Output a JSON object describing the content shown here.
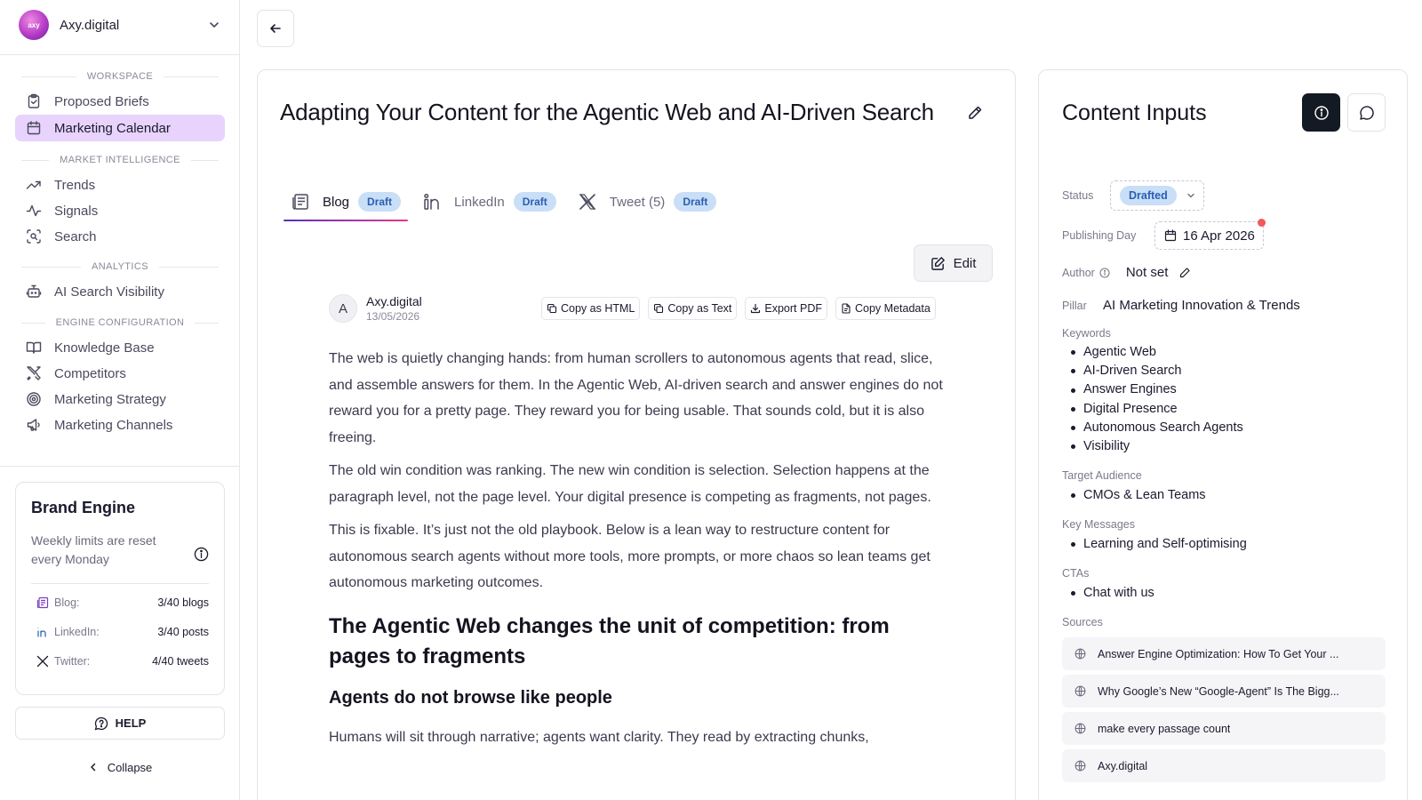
{
  "workspace": {
    "name": "Axy.digital",
    "logo_text": "axy"
  },
  "sidebar": {
    "sections": {
      "workspace": "WORKSPACE",
      "market": "MARKET INTELLIGENCE",
      "analytics": "ANALYTICS",
      "engine": "ENGINE CONFIGURATION"
    },
    "items": {
      "proposed_briefs": "Proposed Briefs",
      "marketing_calendar": "Marketing Calendar",
      "trends": "Trends",
      "signals": "Signals",
      "search": "Search",
      "ai_search_visibility": "AI Search Visibility",
      "knowledge_base": "Knowledge Base",
      "competitors": "Competitors",
      "marketing_strategy": "Marketing Strategy",
      "marketing_channels": "Marketing Channels"
    },
    "active_item": "marketing_calendar"
  },
  "brand_engine": {
    "title": "Brand Engine",
    "subtitle": "Weekly limits are reset every Monday",
    "limits": [
      {
        "label": "Blog:",
        "value": "3/40 blogs",
        "icon": "blog-icon"
      },
      {
        "label": "LinkedIn:",
        "value": "3/40 posts",
        "icon": "linkedin-icon"
      },
      {
        "label": "Twitter:",
        "value": "4/40 tweets",
        "icon": "x-icon"
      }
    ]
  },
  "help_label": "HELP",
  "collapse_label": "Collapse",
  "document": {
    "title": "Adapting Your Content for the Agentic Web and AI-Driven Search",
    "tabs": [
      {
        "label": "Blog",
        "badge": "Draft",
        "icon": "blog-icon",
        "active": true
      },
      {
        "label": "LinkedIn",
        "badge": "Draft",
        "icon": "linkedin-icon",
        "active": false
      },
      {
        "label": "Tweet (5)",
        "badge": "Draft",
        "icon": "x-icon",
        "active": false
      }
    ],
    "edit_label": "Edit",
    "author": {
      "initial": "A",
      "name": "Axy.digital",
      "date": "13/05/2026"
    },
    "actions": {
      "copy_html": "Copy as HTML",
      "copy_text": "Copy as Text",
      "export_pdf": "Export PDF",
      "copy_metadata": "Copy Metadata"
    },
    "paragraphs": [
      "The web is quietly changing hands: from human scrollers to autonomous agents that read, slice, and assemble answers for them. In the Agentic Web, AI-driven search and answer engines do not reward you for a pretty page. They reward you for being usable. That sounds cold, but it is also freeing.",
      "The old win condition was ranking. The new win condition is selection. Selection happens at the paragraph level, not the page level. Your digital presence is competing as fragments, not pages.",
      "This is fixable. It’s just not the old playbook. Below is a lean way to restructure content for autonomous search agents without more tools, more prompts, or more chaos so lean teams get autonomous marketing outcomes."
    ],
    "heading_1": "The Agentic Web changes the unit of competition: from pages to fragments",
    "heading_2": "Agents do not browse like people",
    "paragraph_4": "Humans will sit through narrative; agents want clarity. They read by extracting chunks,"
  },
  "content_inputs": {
    "title": "Content Inputs",
    "status_label": "Status",
    "status_value": "Drafted",
    "publishing_label": "Publishing Day",
    "publishing_value": "16 Apr 2026",
    "author_label": "Author",
    "author_value": "Not set",
    "pillar_label": "Pillar",
    "pillar_value": "AI Marketing Innovation & Trends",
    "keywords_label": "Keywords",
    "keywords": [
      "Agentic Web",
      "AI-Driven Search",
      "Answer Engines",
      "Digital Presence",
      "Autonomous Search Agents",
      "Visibility"
    ],
    "audience_label": "Target Audience",
    "audience": [
      "CMOs & Lean Teams"
    ],
    "messages_label": "Key Messages",
    "messages": [
      "Learning and Self-optimising"
    ],
    "ctas_label": "CTAs",
    "ctas": [
      "Chat with us"
    ],
    "sources_label": "Sources",
    "sources": [
      "Answer Engine Optimization: How To Get Your ...",
      "Why Google’s New “Google-Agent” Is The Bigg...",
      "make every passage count",
      "Axy.digital"
    ]
  },
  "colors": {
    "active_nav_bg": "#e7d3fb",
    "badge_bg": "#c9def7",
    "badge_text": "#2a5fb0",
    "dark_button": "#141a24",
    "tab_underline_start": "#5a2ec0",
    "tab_underline_end": "#e23a8e",
    "notification_dot": "#f05a5a"
  }
}
